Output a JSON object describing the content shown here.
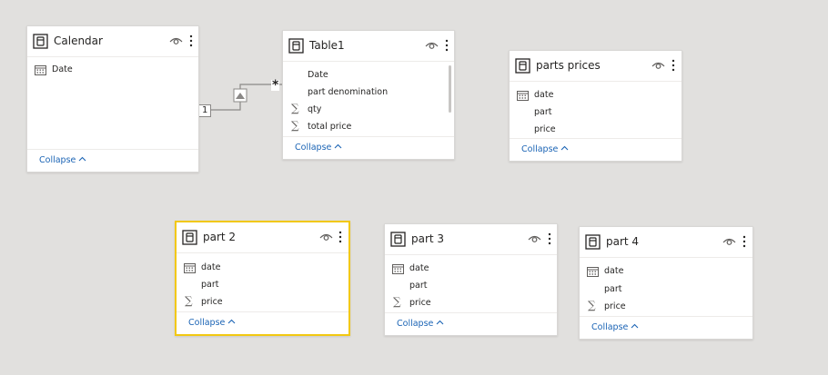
{
  "tables": {
    "calendar": {
      "title": "Calendar",
      "fields": [
        "Date"
      ],
      "collapse": "Collapse"
    },
    "table1": {
      "title": "Table1",
      "fields": [
        "Date",
        "part denomination",
        "qty",
        "total price"
      ],
      "collapse": "Collapse"
    },
    "parts_prices": {
      "title": "parts prices",
      "fields": [
        "date",
        "part",
        "price"
      ],
      "collapse": "Collapse"
    },
    "part2": {
      "title": "part 2",
      "fields": [
        "date",
        "part",
        "price"
      ],
      "collapse": "Collapse"
    },
    "part3": {
      "title": "part 3",
      "fields": [
        "date",
        "part",
        "price"
      ],
      "collapse": "Collapse"
    },
    "part4": {
      "title": "part 4",
      "fields": [
        "date",
        "part",
        "price"
      ],
      "collapse": "Collapse"
    }
  },
  "relationship": {
    "from_cardinality": "1",
    "to_cardinality": "*"
  },
  "colors": {
    "accent_link": "#1b64b5",
    "selected_border": "#f2c811",
    "canvas": "#e1e0de"
  },
  "icons": [
    "table-icon",
    "eye-icon",
    "more-options-icon",
    "calendar-icon",
    "sigma-icon",
    "chevron-up-icon",
    "filter-direction-icon"
  ]
}
